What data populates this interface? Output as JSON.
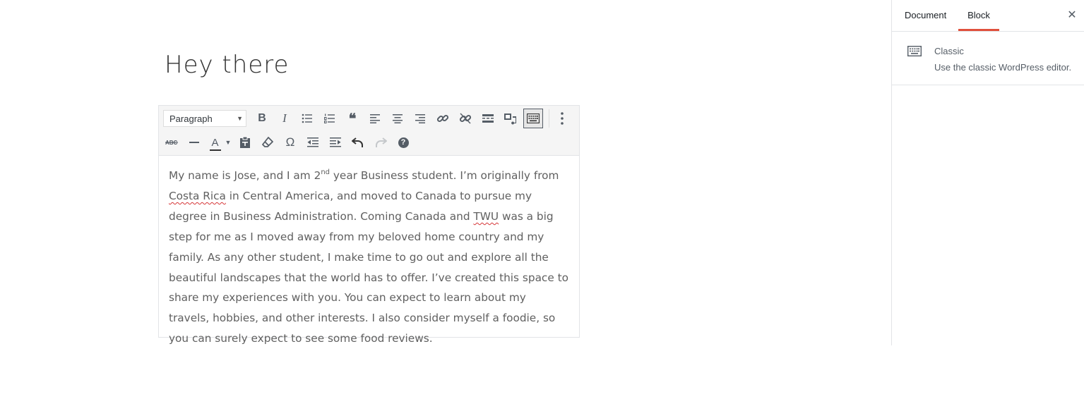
{
  "post": {
    "title": "Hey there"
  },
  "toolbar": {
    "format_value": "Paragraph",
    "row1": [
      "bold",
      "italic",
      "bullet-list",
      "numbered-list",
      "blockquote",
      "align-left",
      "align-center",
      "align-right",
      "insert-link",
      "remove-link",
      "read-more",
      "distraction-free",
      "toolbar-toggle",
      "more-options"
    ],
    "row2": [
      "strikethrough",
      "horizontal-line",
      "text-color",
      "paste-as-text",
      "clear-formatting",
      "special-character",
      "decrease-indent",
      "increase-indent",
      "undo",
      "redo",
      "keyboard-shortcuts"
    ],
    "bold_glyph": "B",
    "italic_glyph": "I",
    "quote_glyph": "❝",
    "omega_glyph": "Ω",
    "textcolor_glyph": "A",
    "help_glyph": "?"
  },
  "content": {
    "p1_a": "My name is Jose, and I am 2",
    "p1_sup": "nd",
    "p1_b": " year Business student. I’m originally from ",
    "p1_spell1": "Costa Rica",
    "p1_c": " in Central America, and moved to Canada to pursue my degree in Business Administration. Coming Canada and ",
    "p1_spell2": "TWU",
    "p1_d": " was a big step for me as I moved away from my beloved home country and my family. As any other student, I make time to go out and explore all the beautiful landscapes that the world has to offer. I’ve created this space to share my experiences with you. You can expect to learn about my travels, hobbies, and other interests. I also consider myself a foodie, so you can surely expect to see some food reviews."
  },
  "sidebar": {
    "tabs": [
      {
        "label": "Document",
        "active": false
      },
      {
        "label": "Block",
        "active": true
      }
    ],
    "close_glyph": "✕",
    "block_card": {
      "icon": "keyboard-icon",
      "name": "Classic",
      "description": "Use the classic WordPress editor."
    },
    "accent_color": "#e0503c"
  }
}
